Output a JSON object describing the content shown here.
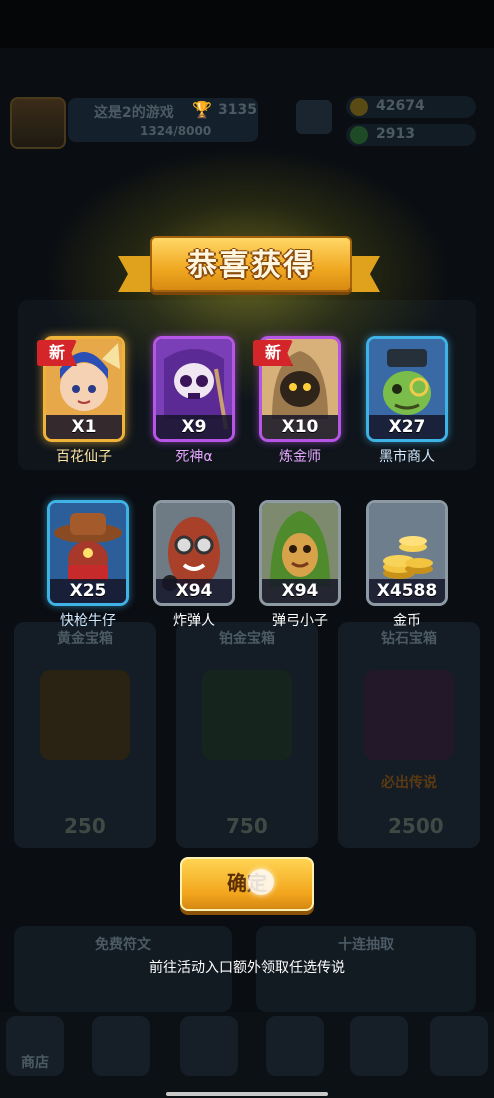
{
  "background": {
    "player_name": "这是2的游戏",
    "trophy_count": "3135",
    "exp_progress": "1324/8000",
    "coins": "42674",
    "gems": "2913",
    "chests": [
      {
        "label": "黄金宝箱",
        "price": "250"
      },
      {
        "label": "铂金宝箱",
        "price": "750"
      },
      {
        "label": "钻石宝箱",
        "price": "2500"
      }
    ],
    "chest_badge": "必出传说",
    "bottom_left_panel": "免费符文",
    "bottom_right_panel": "十连抽取",
    "nav_shop": "商店"
  },
  "popup": {
    "title": "恭喜获得",
    "new_label": "新",
    "rewards": [
      {
        "name": "百花仙子",
        "qty": "X1",
        "rarity": "gold",
        "is_new": true,
        "icon": "flower-fairy-portrait"
      },
      {
        "name": "死神α",
        "qty": "X9",
        "rarity": "purple",
        "is_new": false,
        "icon": "reaper-skull-portrait"
      },
      {
        "name": "炼金师",
        "qty": "X10",
        "rarity": "purple",
        "is_new": true,
        "icon": "alchemist-hooded-portrait"
      },
      {
        "name": "黑市商人",
        "qty": "X27",
        "rarity": "blue",
        "is_new": false,
        "icon": "black-market-merchant-portrait"
      },
      {
        "name": "快枪牛仔",
        "qty": "X25",
        "rarity": "blue",
        "is_new": false,
        "icon": "cowboy-portrait"
      },
      {
        "name": "炸弹人",
        "qty": "X94",
        "rarity": "gray",
        "is_new": false,
        "icon": "bomber-portrait"
      },
      {
        "name": "弹弓小子",
        "qty": "X94",
        "rarity": "gray",
        "is_new": false,
        "icon": "slingshot-kid-portrait"
      },
      {
        "name": "金币",
        "qty": "X4588",
        "rarity": "gray",
        "is_new": false,
        "icon": "gold-coins-stack"
      }
    ],
    "confirm_label": "确定",
    "hint": "前往活动入口额外领取任选传说"
  },
  "colors": {
    "gold": "#f1b23a",
    "purple": "#b655e6",
    "blue": "#3fb2e6",
    "gray": "#8e9aa3",
    "confirm": "#f2a51c"
  }
}
